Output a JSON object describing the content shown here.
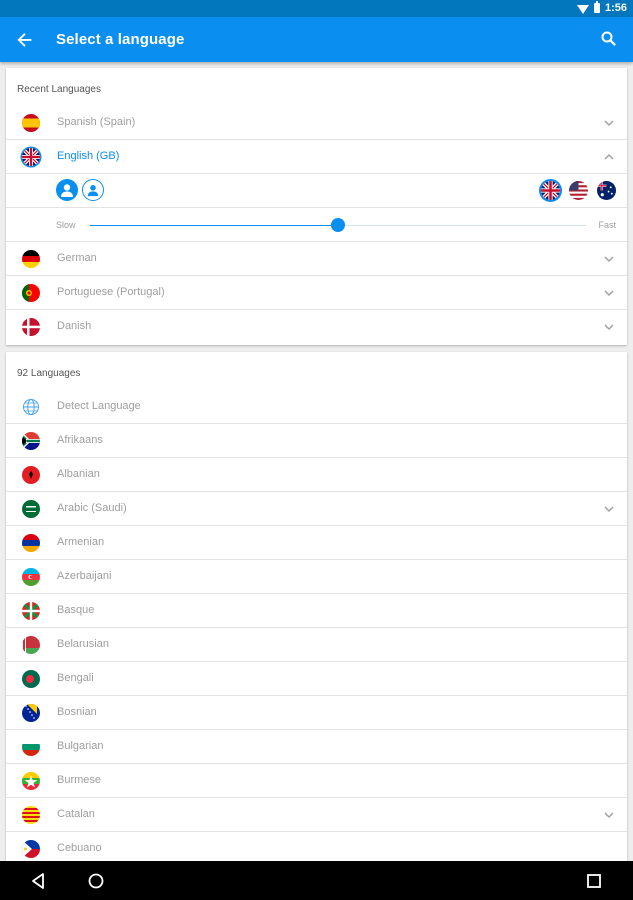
{
  "status_bar": {
    "time": "1:56"
  },
  "app_bar": {
    "title": "Select a language"
  },
  "recent": {
    "heading": "Recent Languages",
    "items": [
      {
        "label": "Spanish (Spain)",
        "flag": "es"
      },
      {
        "label": "English (GB)",
        "flag": "gb"
      },
      {
        "label": "German",
        "flag": "de"
      },
      {
        "label": "Portuguese (Portugal)",
        "flag": "pt"
      },
      {
        "label": "Danish",
        "flag": "dk"
      }
    ],
    "speed": {
      "slow_label": "Slow",
      "fast_label": "Fast",
      "level": 0.5
    }
  },
  "all": {
    "heading": "92 Languages",
    "items": [
      {
        "label": "Detect Language",
        "icon": "globe-icon"
      },
      {
        "label": "Afrikaans",
        "flag": "za"
      },
      {
        "label": "Albanian",
        "flag": "al"
      },
      {
        "label": "Arabic (Saudi)",
        "flag": "sa"
      },
      {
        "label": "Armenian",
        "flag": "am"
      },
      {
        "label": "Azerbaijani",
        "flag": "az"
      },
      {
        "label": "Basque",
        "flag": "eu"
      },
      {
        "label": "Belarusian",
        "flag": "by"
      },
      {
        "label": "Bengali",
        "flag": "bd"
      },
      {
        "label": "Bosnian",
        "flag": "ba"
      },
      {
        "label": "Bulgarian",
        "flag": "bg"
      },
      {
        "label": "Burmese",
        "flag": "mm"
      },
      {
        "label": "Catalan",
        "flag": "ct"
      },
      {
        "label": "Cebuano",
        "flag": "ph"
      }
    ]
  },
  "colors": {
    "accent": "#0a8ff0",
    "status_bar": "#0277bd",
    "text_muted": "#9e9e9e"
  }
}
